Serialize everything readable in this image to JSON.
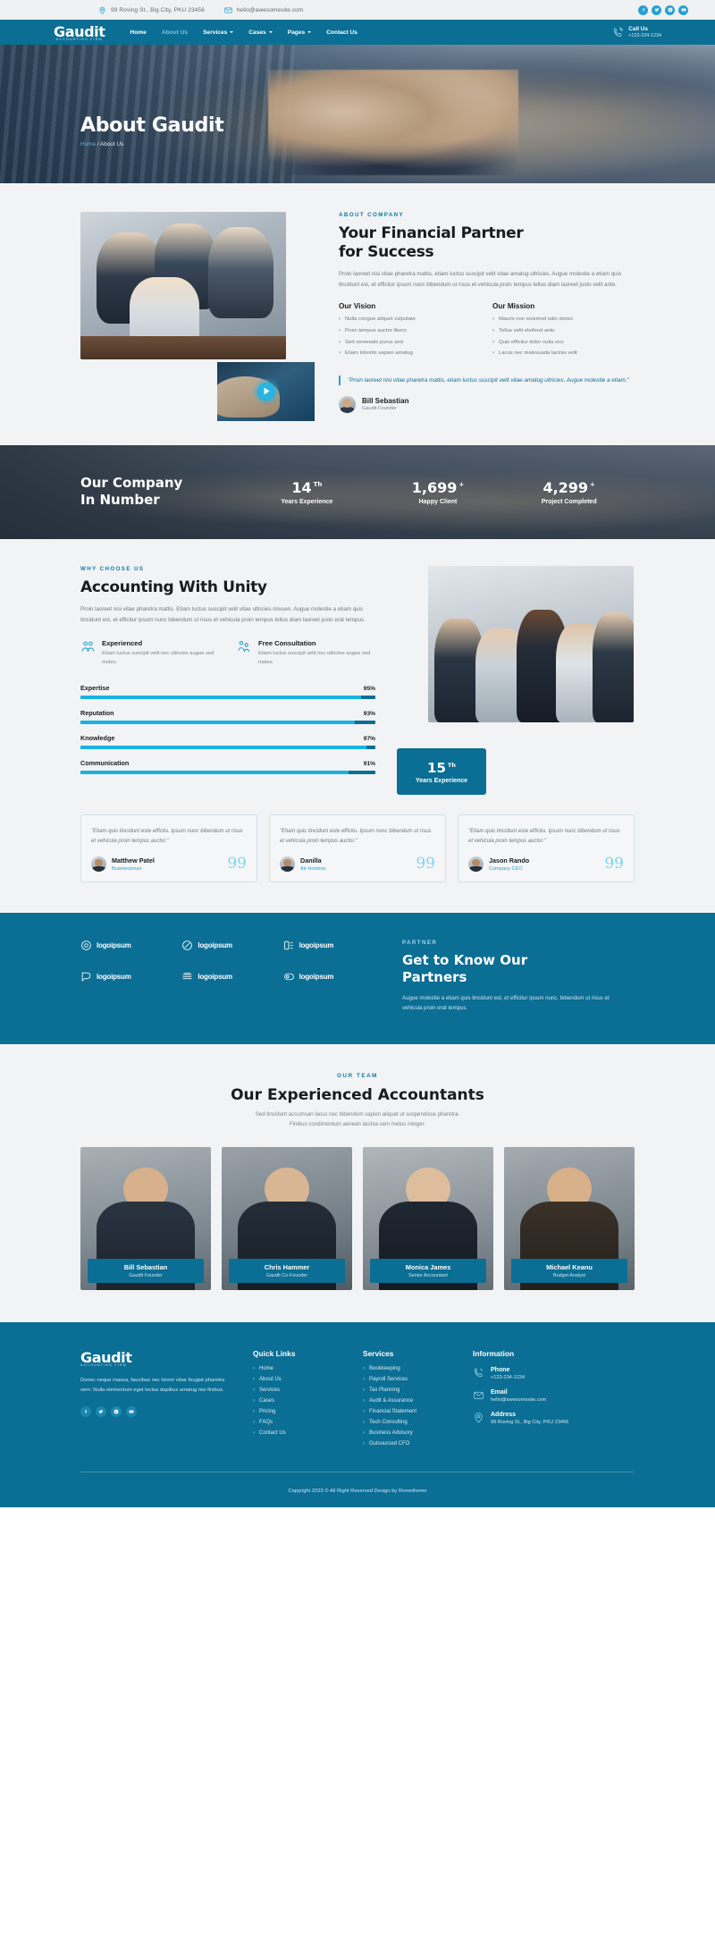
{
  "topbar": {
    "address": "99 Roving St., Big City, PKU 23456",
    "email": "hello@awesomesite.com",
    "socials": [
      "facebook-icon",
      "twitter-icon",
      "instagram-icon",
      "youtube-icon"
    ]
  },
  "nav": {
    "logo": "Gaudit",
    "logo_sub": "ACCOUNTING FIRM",
    "items": [
      {
        "label": "Home",
        "caret": false,
        "active": false
      },
      {
        "label": "About Us",
        "caret": false,
        "active": true
      },
      {
        "label": "Services",
        "caret": true,
        "active": false
      },
      {
        "label": "Cases",
        "caret": true,
        "active": false
      },
      {
        "label": "Pages",
        "caret": true,
        "active": false
      },
      {
        "label": "Contact Us",
        "caret": false,
        "active": false
      }
    ],
    "call_label": "Call Us",
    "call_number": "+123-234-1234"
  },
  "hero": {
    "title": "About Gaudit",
    "crumb_home": "Home",
    "crumb_rest": "/ About Us"
  },
  "about": {
    "eyebrow": "ABOUT COMPANY",
    "heading_line1": "Your Financial Partner",
    "heading_line2": "for Success",
    "lead": "Proin laoreet nisi vitae pharetra mattis, etiam luctus suscipit velit vitae amatug ultricies. Augue molestie a etiam quis tincidunt est, et efficitur ipsum nunc bibendum ut risus et vehicula proin tempus tellus diam laoreet justo velit ante.",
    "vision_title": "Our Vision",
    "vision_items": [
      "Nulla congue aliquet vulputate",
      "Proin tempus auctor libero",
      "Sed venenatis purus sed",
      "Etiam lobortis sapien amatug"
    ],
    "mission_title": "Our Mission",
    "mission_items": [
      "Mauris non euismod odio donec",
      "Tellus velit eleifend ante",
      "Quis efficitur dolor nulla orci",
      "Lacus nec malesuada lacinia velit"
    ],
    "quote": "\"Proin laoreet nisi vitae pharetra mattis, etiam luctus suscipit velit vitae amatug ultricies. Augue molestie a etiam.\"",
    "author_name": "Bill Sebastian",
    "author_role": "Gaudit Founder"
  },
  "stats": {
    "title_line1": "Our Company",
    "title_line2": "In Number",
    "items": [
      {
        "value": "14",
        "sup": "Th",
        "label": "Years Experience"
      },
      {
        "value": "1,699",
        "sup": "+",
        "label": "Happy Client"
      },
      {
        "value": "4,299",
        "sup": "+",
        "label": "Project Completed"
      }
    ]
  },
  "why": {
    "eyebrow": "WHY CHOOSE US",
    "heading": "Accounting With Unity",
    "lead": "Proin laoreet nisi vitae pharetra mattis. Etiam luctus suscipit velit vitae ultricies mixuen. Augue molestie a etiam quis tincidunt est, et efficitur ipsum nunc bibendum ut risus et vehicula proin tempus tellus diam laoreet justo erat tempus.",
    "features": [
      {
        "icon": "team-icon",
        "title": "Experienced",
        "text": "Etiam luctus suscipit velit nec ultricies augue sed moles."
      },
      {
        "icon": "consult-icon",
        "title": "Free Consultation",
        "text": "Etiam luctus suscipit velit nec ultricies augue sed moles."
      }
    ],
    "bars": [
      {
        "label": "Expertise",
        "value": "95%",
        "pct": 95
      },
      {
        "label": "Reputation",
        "value": "93%",
        "pct": 93
      },
      {
        "label": "Knowledge",
        "value": "97%",
        "pct": 97
      },
      {
        "label": "Communication",
        "value": "91%",
        "pct": 91
      }
    ],
    "badge_value": "15",
    "badge_sup": "Th",
    "badge_label": "Years Experience"
  },
  "testimonials": [
    {
      "quote": "\"Etiam quis tincidunt este efficitu. Ipsum nunc bibendum ut risus et vehicula proin tempus auctor.\"",
      "name": "Matthew Patel",
      "role": "Businessman"
    },
    {
      "quote": "\"Etiam quis tincidunt este efficitu. Ipsum nunc bibendum ut risus et vehicula proin tempus auctor.\"",
      "name": "Danilla",
      "role": "Air Hostess"
    },
    {
      "quote": "\"Etiam quis tincidunt este efficitu. Ipsum nunc bibendum ut risus et vehicula proin tempus auctor.\"",
      "name": "Jason Rando",
      "role": "Company CEO"
    }
  ],
  "partners": {
    "eyebrow": "PARTNER",
    "heading_line1": "Get to Know Our",
    "heading_line2": "Partners",
    "text": "Augue molestie a etiam quis tincidunt est, et efficitur ipsum nunc. bibendum ut risus et vehicula proin erat tempus.",
    "logos": [
      {
        "icon": "logo-target-icon",
        "label": "logoipsum"
      },
      {
        "icon": "logo-slash-icon",
        "label": "logoipsum"
      },
      {
        "icon": "logo-blocks-icon",
        "label": "logoipsum"
      },
      {
        "icon": "logo-corner-icon",
        "label": "logoipsum"
      },
      {
        "icon": "logo-stack-icon",
        "label": "logoipsum"
      },
      {
        "icon": "logo-pill-icon",
        "label": "logoipsum"
      }
    ]
  },
  "team": {
    "eyebrow": "OUR TEAM",
    "heading": "Our Experienced Accountants",
    "sub_line1": "Sed tincidunt accumsan lacus nec bibendum sapien aliquet ut suspendisse pharetra.",
    "sub_line2": "Finibus condimentum aenean lacinia sem metus integer.",
    "members": [
      {
        "name": "Bill Sebastian",
        "role": "Gaudit Founder"
      },
      {
        "name": "Chris Hammer",
        "role": "Gaudit Co-Founder"
      },
      {
        "name": "Monica James",
        "role": "Senior Accountant"
      },
      {
        "name": "Michael Keanu",
        "role": "Budget Analyst"
      }
    ]
  },
  "footer": {
    "logo": "Gaudit",
    "logo_sub": "ACCOUNTING FIRM",
    "about": "Donec neque massa, faucibus nec lorem vitae feugiat pharetra sem. Nulla elementum eget lectus dapibus amatug nisi finibus.",
    "socials": [
      "facebook-icon",
      "twitter-icon",
      "instagram-icon",
      "youtube-icon"
    ],
    "quick_title": "Quick Links",
    "quick_items": [
      "Home",
      "About Us",
      "Services",
      "Cases",
      "Pricing",
      "FAQs",
      "Contact Us"
    ],
    "services_title": "Services",
    "services_items": [
      "Bookkeeping",
      "Payroll Services",
      "Tax Planning",
      "Audit & Assurance",
      "Financial Statement",
      "Tech Consulting",
      "Business Advisory",
      "Outsourced CFO"
    ],
    "info_title": "Information",
    "info_items": [
      {
        "icon": "phone-icon",
        "title": "Phone",
        "value": "+123-234-1234"
      },
      {
        "icon": "mail-icon",
        "title": "Email",
        "value": "hello@awesomesite.com"
      },
      {
        "icon": "pin-icon",
        "title": "Address",
        "value": "99 Roving St., Big City, PKU 23456"
      }
    ],
    "copyright": "Copyright 2023 © All Right Reserved Design by Rometheme"
  },
  "colors": {
    "brand": "#0b6e94",
    "accent": "#2a9fd0",
    "bar_fill": "#18b3e3",
    "page_bg": "#f2f3f4"
  }
}
